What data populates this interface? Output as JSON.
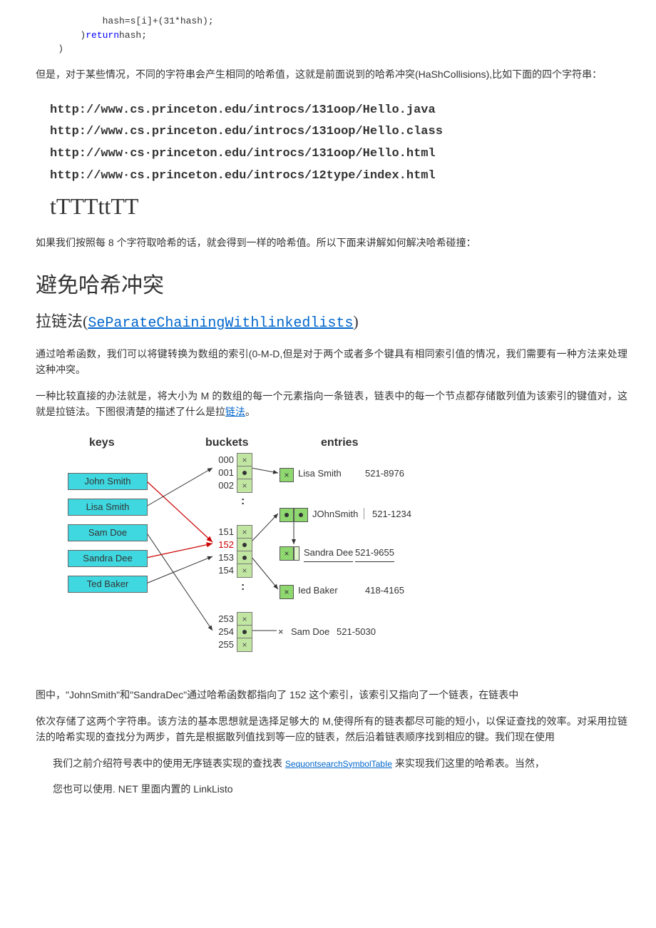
{
  "code": {
    "line1": "            hash=s[i]+(31*hash);",
    "line2_a": "        )",
    "line2_return": "return",
    "line2_b": "hash;",
    "line3": "    )"
  },
  "para1": "但是，对于某些情况，不同的字符串会产生相同的哈希值，这就是前面说到的哈希冲突(HaShCollisions),比如下面的四个字符串：",
  "urls": {
    "u1": "http://www.cs.princeton.edu/introcs/131oop/Hello.java",
    "u2": "http://www.cs.princeton.edu/introcs/131oop/Hello.class",
    "u3": "http://www·cs·princeton.edu/introcs/131oop/Hello.html",
    "u4": "http://www·cs.princeton.edu/introcs/12type/index.html",
    "tt": "tTTTttTT"
  },
  "para2": "如果我们按照每 8 个字符取哈希的话，就会得到一样的哈希值。所以下面来讲解如何解决哈希碰撞：",
  "section_title": "避免哈希冲突",
  "subsection_label": "拉链法",
  "subsection_link": "SeParateChainingWithlinkedlists",
  "para3": "通过哈希函数，我们可以将键转换为数组的索引(0-M-D,但是对于两个或者多个键具有相同索引值的情况，我们需要有一种方法来处理这种冲突。",
  "para4_a": "一种比较直接的办法就是，将大小为 M 的数组的每一个元素指向一条链表，链表中的每一个节点都存储散列值为该索引的键值对，这就是拉链法。下图很清楚的描述了什么是拉",
  "para4_link": "链法",
  "para4_b": "。",
  "diagram": {
    "headers": {
      "keys": "keys",
      "buckets": "buckets",
      "entries": "entries"
    },
    "keylabels": [
      "John Smith",
      "Lisa Smith",
      "Sam Doe",
      "Sandra Dee",
      "Ted Baker"
    ],
    "bucket_nums": [
      "000",
      "001",
      "002",
      "151",
      "152",
      "153",
      "154",
      "253",
      "254",
      "255"
    ],
    "entries": {
      "e1_name": "Lisa Smith",
      "e1_val": "521-8976",
      "e2_name": "JOhnSmith",
      "e2_val": "521-1234",
      "e3_name": "Sandra Dee",
      "e3_val": "521-9655",
      "e4_name": "Ied Baker",
      "e4_val": "418-4165",
      "e5_name": "Sam Doe",
      "e5_val": "521-5030"
    }
  },
  "para5": "图中，\"JohnSmith\"和\"SandraDec\"通过哈希函数都指向了 152 这个索引，该索引又指向了一个链表，在链表中",
  "para6": "依次存储了这两个字符串。该方法的基本思想就是选择足够大的 M,使得所有的链表都尽可能的短小，以保证查找的效率。对采用拉链法的哈希实现的查找分为两步，首先是根据散列值找到等一应的链表，然后沿着链表顺序找到相应的键。我们现在使用",
  "para7_a": "我们之前介绍符号表中的使用无序链表实现的查找表 ",
  "para7_link": "SequontsearchSymbolTabIe",
  "para7_b": " 来实现我们这里的哈希表。当然，",
  "para8": "您也可以使用. NET 里面内置的 LinkListo"
}
